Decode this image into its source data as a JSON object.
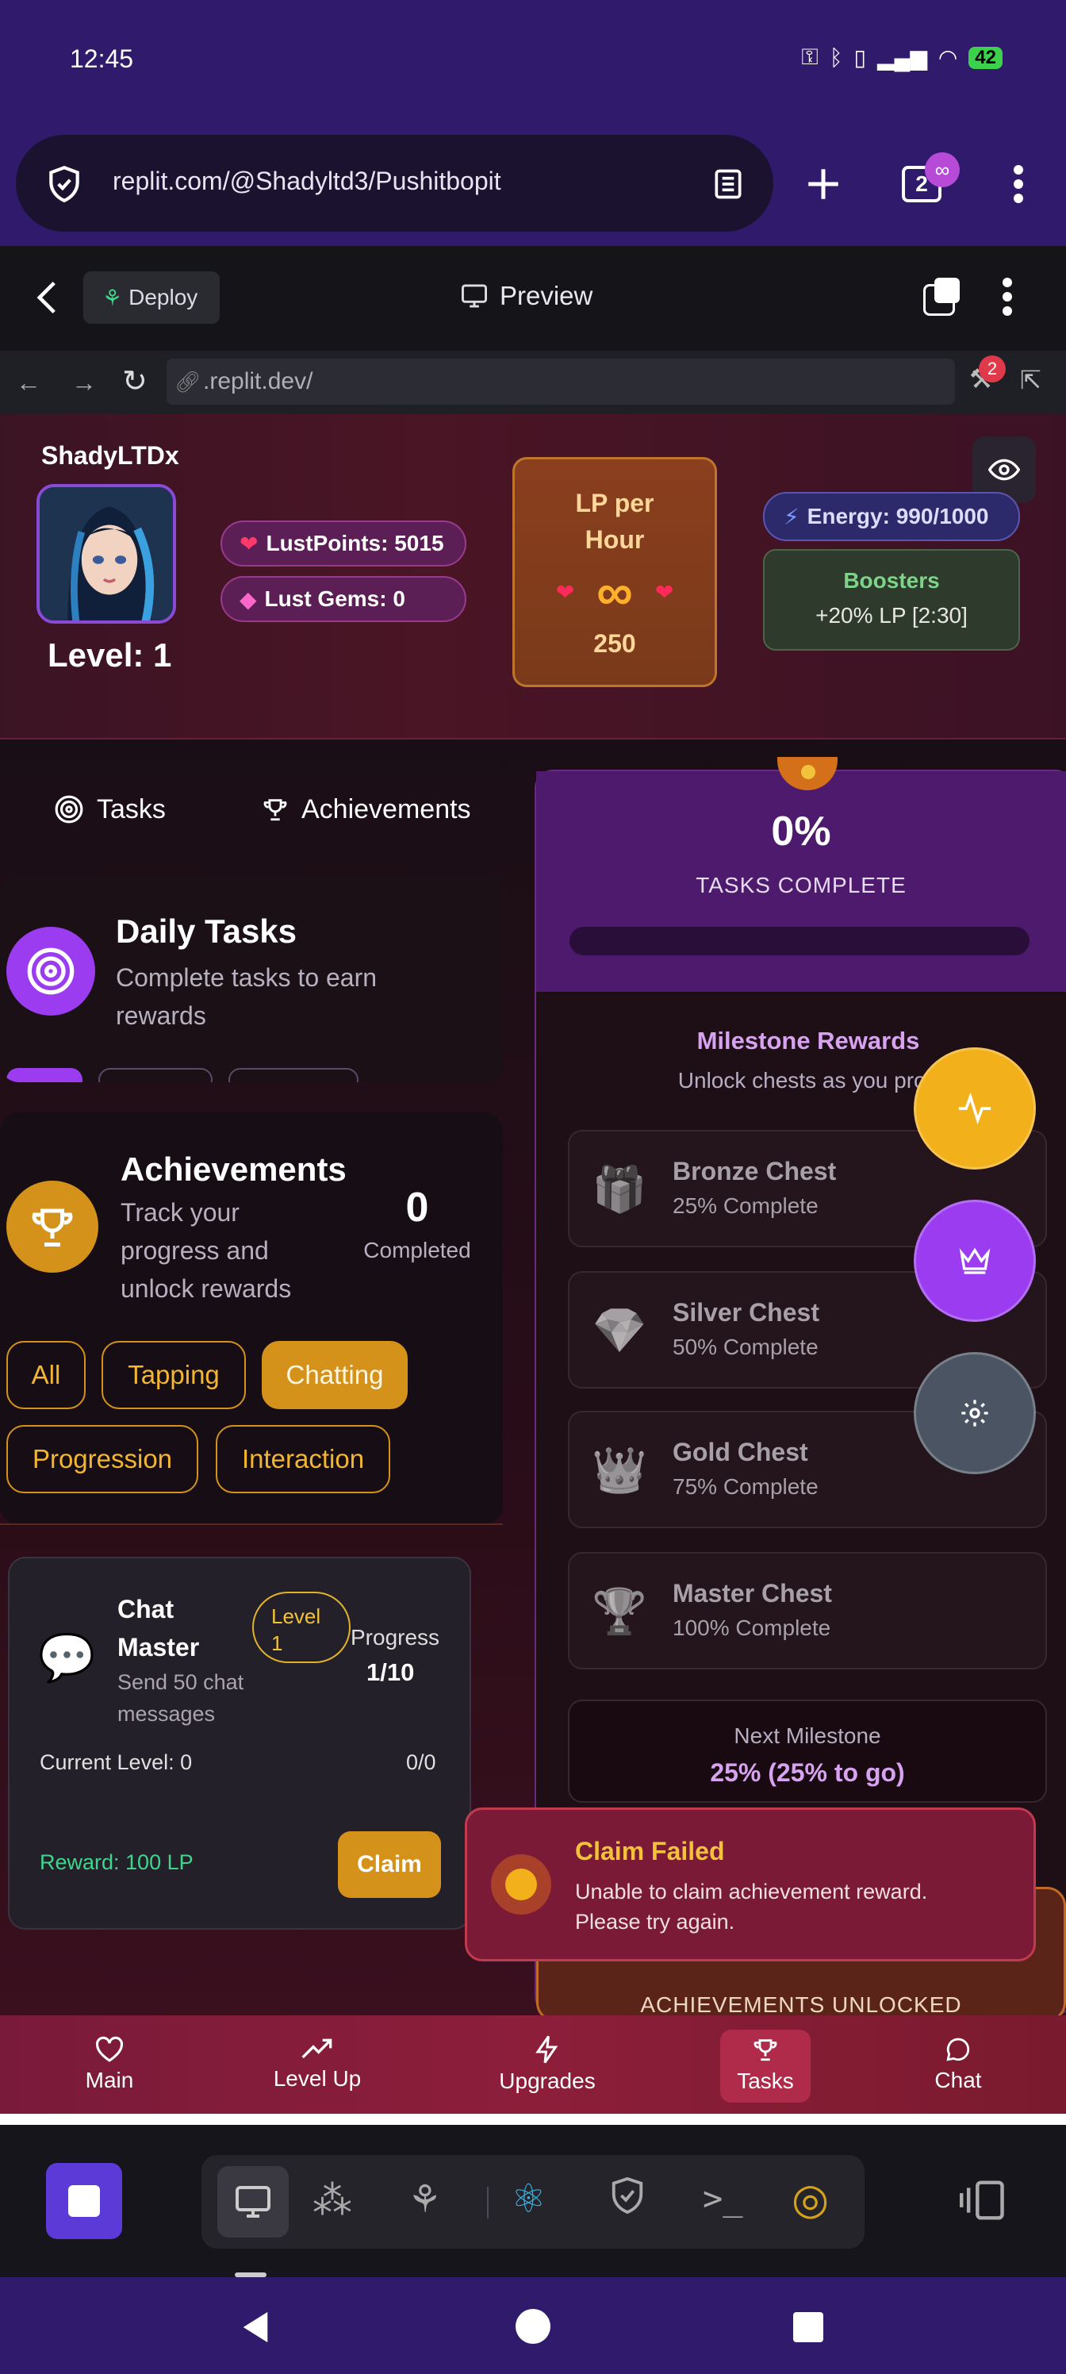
{
  "status_bar": {
    "time": "12:45",
    "battery": "42"
  },
  "browser": {
    "url": "replit.com/@Shadyltd3/Pushitbopit",
    "tab_count": "2"
  },
  "replit": {
    "deploy_label": "Deploy",
    "preview_label": "Preview",
    "address": ".replit.dev/",
    "badge_count": "2"
  },
  "header": {
    "username": "ShadyLTDx",
    "level": "Level: 1",
    "lust_points": "LustPoints: 5015",
    "lust_gems": "Lust Gems: 0",
    "lp_per_hour_title": "LP per Hour",
    "lp_symbol": "∞",
    "lp_per_hour_value": "250",
    "energy": "Energy: 990/1000",
    "boosters_title": "Boosters",
    "boosters_value": "+20% LP [2:30]"
  },
  "tabs": [
    {
      "label": "Tasks"
    },
    {
      "label": "Achievements"
    }
  ],
  "daily": {
    "title": "Daily Tasks",
    "subtitle": "Complete tasks to earn rewards"
  },
  "achievements": {
    "title": "Achievements",
    "subtitle": "Track your progress and unlock rewards",
    "count": "0",
    "count_label": "Completed",
    "filters": [
      "All",
      "Tapping",
      "Chatting",
      "Progression",
      "Interaction"
    ],
    "active_filter": "Chatting"
  },
  "chat_card": {
    "title": "Chat Master",
    "level_badge": "Level 1",
    "description": "Send 50 chat messages",
    "progress_label": "Progress",
    "progress_value": "1/10",
    "current_level": "Current Level: 0",
    "current_ratio": "0/0",
    "reward": "Reward: 100 LP",
    "claim_label": "Claim"
  },
  "progress_panel": {
    "percent": "0%",
    "label": "TASKS COMPLETE",
    "progress": 0,
    "milestone_title": "Milestone Rewards",
    "milestone_sub": "Unlock chests as you prog",
    "chests": [
      {
        "name": "Bronze Chest",
        "pct": "25% Complete",
        "icon": "🎁"
      },
      {
        "name": "Silver Chest",
        "pct": "50% Complete",
        "icon": "💎"
      },
      {
        "name": "Gold Chest",
        "pct": "75% Complete",
        "icon": "👑"
      },
      {
        "name": "Master Chest",
        "pct": "100% Complete",
        "icon": "🏆"
      }
    ],
    "next_label": "Next Milestone",
    "next_value": "25% (25% to go)",
    "ach_unlocked_label": "ACHIEVEMENTS UNLOCKED"
  },
  "toast": {
    "title": "Claim Failed",
    "message": "Unable to claim achievement reward. Please try again."
  },
  "bottom_nav": [
    {
      "label": "Main"
    },
    {
      "label": "Level Up"
    },
    {
      "label": "Upgrades"
    },
    {
      "label": "Tasks"
    },
    {
      "label": "Chat"
    }
  ],
  "colors": {
    "accent_purple": "#9b3cf0",
    "accent_gold": "#d4921a",
    "toast_bg": "#7a1a36"
  }
}
